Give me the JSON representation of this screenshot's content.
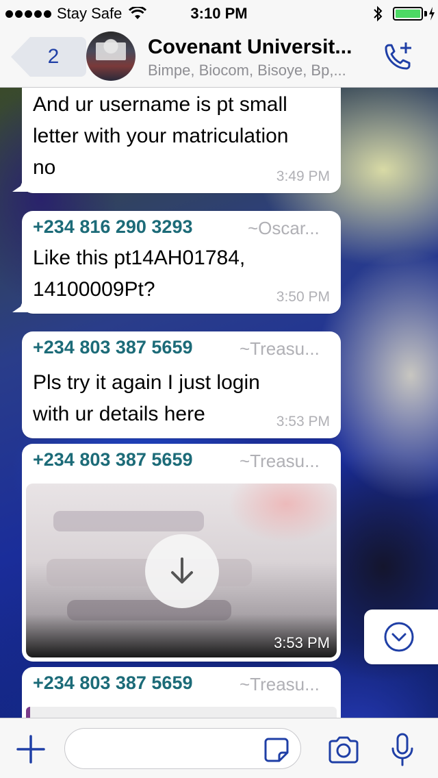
{
  "status_bar": {
    "carrier": "Stay Safe",
    "time": "3:10 PM",
    "battery_level": 1.0
  },
  "header": {
    "back_count": "2",
    "title": "Covenant Universit...",
    "subtitle": "Bimpe, Biocom, Bisoye, Bp,...",
    "accent_color": "#1f3fa6"
  },
  "messages": [
    {
      "lines": [
        "And ur username is pt small",
        "letter with your matriculation",
        "no"
      ],
      "time": "3:49 PM"
    },
    {
      "sender_phone": "+234 816 290 3293",
      "sender_name": "~Oscar...",
      "lines": [
        "Like this pt14AH01784,",
        "14100009Pt?"
      ],
      "time": "3:50 PM"
    },
    {
      "sender_phone": "+234 803 387 5659",
      "sender_name": "~Treasu...",
      "lines": [
        "Pls try it again I just login",
        "with ur details here"
      ],
      "time": "3:53 PM"
    },
    {
      "sender_phone": "+234 803 387 5659",
      "sender_name": "~Treasu...",
      "media": "image-download",
      "time": "3:53 PM"
    },
    {
      "sender_phone": "+234 803 387 5659",
      "sender_name": "~Treasu..."
    }
  ],
  "input_bar": {
    "placeholder": ""
  },
  "icons": {
    "back": "back-arrow-icon",
    "call": "add-call-icon",
    "download": "download-arrow-icon",
    "scroll": "chevron-down-circle-icon",
    "add": "plus-icon",
    "sticker": "sticker-icon",
    "camera": "camera-icon",
    "mic": "microphone-icon"
  }
}
